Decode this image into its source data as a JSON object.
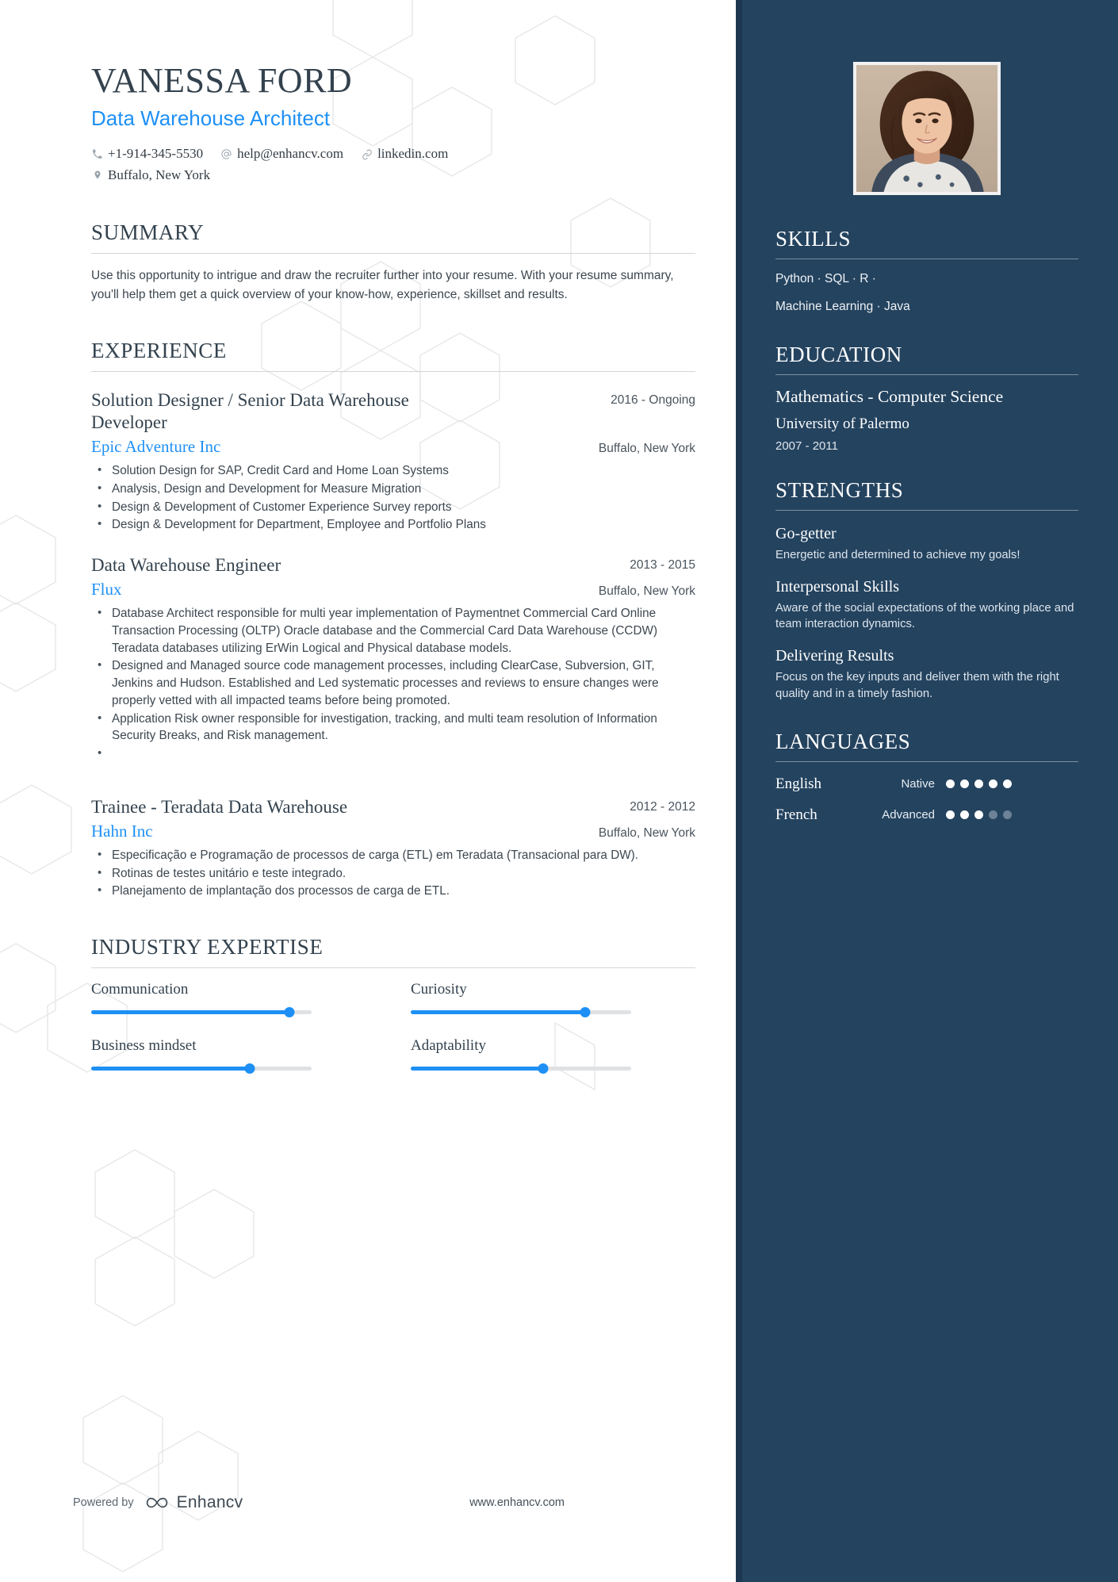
{
  "header": {
    "name": "VANESSA FORD",
    "role": "Data Warehouse Architect",
    "phone": "+1-914-345-5530",
    "email": "help@enhancv.com",
    "linkedin": "linkedin.com",
    "location": "Buffalo, New York"
  },
  "summary": {
    "title": "SUMMARY",
    "text": "Use this opportunity to intrigue and draw the recruiter further into your resume. With your resume summary, you'll help them get a quick overview of your know-how, experience, skillset and results."
  },
  "experience": {
    "title": "EXPERIENCE",
    "jobs": [
      {
        "title": "Solution Designer / Senior Data Warehouse Developer",
        "dates": "2016 - Ongoing",
        "company": "Epic Adventure Inc",
        "location": "Buffalo, New York",
        "bullets": [
          "Solution Design for SAP, Credit Card and Home Loan Systems",
          "Analysis, Design and Development for Measure Migration",
          "Design & Development of Customer Experience Survey reports",
          "Design & Development for Department, Employee and Portfolio Plans"
        ]
      },
      {
        "title": "Data Warehouse Engineer",
        "dates": "2013 - 2015",
        "company": "Flux",
        "location": "Buffalo, New York",
        "bullets": [
          "Database Architect responsible for multi year implementation of Paymentnet Commercial Card Online Transaction Processing (OLTP) Oracle database and the Commercial Card Data Warehouse (CCDW) Teradata databases utilizing ErWin Logical and Physical database models.",
          "Designed and Managed source code management processes, including ClearCase, Subversion, GIT, Jenkins and Hudson. Established and Led systematic processes and reviews to ensure changes were properly vetted with all impacted teams before being promoted.",
          "Application Risk owner responsible for investigation, tracking, and multi team resolution of Information Security Breaks, and Risk management.",
          ""
        ]
      },
      {
        "title": "Trainee - Teradata Data Warehouse",
        "dates": "2012 - 2012",
        "company": "Hahn Inc",
        "location": "Buffalo, New York",
        "bullets": [
          "Especificação e Programação de processos de carga (ETL) em Teradata (Transacional para DW).",
          "Rotinas de testes unitário e teste integrado.",
          "Planejamento de implantação dos processos de carga de ETL."
        ]
      }
    ]
  },
  "industry_expertise": {
    "title": "INDUSTRY EXPERTISE",
    "items": [
      {
        "label": "Communication",
        "value": 90
      },
      {
        "label": "Curiosity",
        "value": 79
      },
      {
        "label": "Business mindset",
        "value": 72
      },
      {
        "label": "Adaptability",
        "value": 60
      }
    ]
  },
  "footer": {
    "powered_by": "Powered by",
    "brand": "Enhancv",
    "website": "www.enhancv.com"
  },
  "sidebar": {
    "skills": {
      "title": "SKILLS",
      "lines": [
        "Python · SQL ·  R  ·",
        "Machine Learning · Java"
      ]
    },
    "education": {
      "title": "EDUCATION",
      "degree": "Mathematics - Computer Science",
      "school": "University of Palermo",
      "dates": "2007 - 2011"
    },
    "strengths": {
      "title": "STRENGTHS",
      "items": [
        {
          "name": "Go-getter",
          "desc": "Energetic and determined to achieve my goals!"
        },
        {
          "name": "Interpersonal Skills",
          "desc": "Aware of the social expectations of the working place and team interaction dynamics."
        },
        {
          "name": "Delivering Results",
          "desc": "Focus on the key inputs and deliver them with the right quality and in a timely fashion."
        }
      ]
    },
    "languages": {
      "title": "LANGUAGES",
      "items": [
        {
          "name": "English",
          "level": "Native",
          "dots": 5,
          "total": 5
        },
        {
          "name": "French",
          "level": "Advanced",
          "dots": 3,
          "total": 5
        }
      ]
    }
  },
  "colors": {
    "accent": "#1e90f5",
    "sidebar_bg": "#24435f",
    "heading": "#33424e"
  }
}
